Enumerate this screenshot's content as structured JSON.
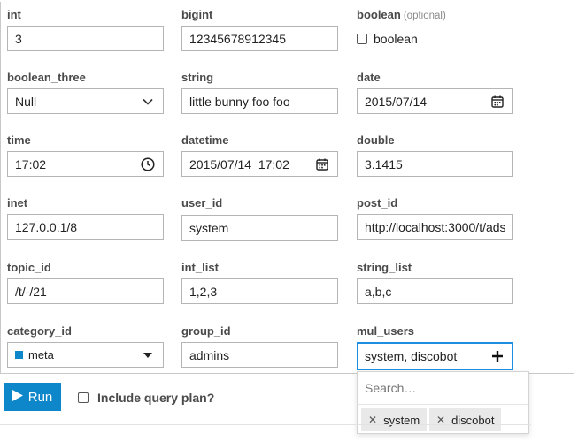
{
  "fields": {
    "int": {
      "label": "int",
      "value": "3"
    },
    "bigint": {
      "label": "bigint",
      "value": "12345678912345"
    },
    "boolean": {
      "label": "boolean",
      "optional": "(optional)",
      "checkbox_label": "boolean"
    },
    "boolean_three": {
      "label": "boolean_three",
      "value": "Null"
    },
    "string": {
      "label": "string",
      "value": "little bunny foo foo"
    },
    "date": {
      "label": "date",
      "value": "2015/07/14"
    },
    "time": {
      "label": "time",
      "value": "17:02"
    },
    "datetime": {
      "label": "datetime",
      "value": "2015/07/14  17:02"
    },
    "double": {
      "label": "double",
      "value": "3.1415"
    },
    "inet": {
      "label": "inet",
      "value": "127.0.0.1/8"
    },
    "user_id": {
      "label": "user_id",
      "value": "system"
    },
    "post_id": {
      "label": "post_id",
      "value": "http://localhost:3000/t/ads"
    },
    "topic_id": {
      "label": "topic_id",
      "value": "/t/-/21"
    },
    "int_list": {
      "label": "int_list",
      "value": "1,2,3"
    },
    "string_list": {
      "label": "string_list",
      "value": "a,b,c"
    },
    "category_id": {
      "label": "category_id",
      "value": "meta",
      "swatch_color": "#0e86ca"
    },
    "group_id": {
      "label": "group_id",
      "value": "admins"
    },
    "mul_users": {
      "label": "mul_users",
      "value": "system, discobot"
    }
  },
  "user_dropdown": {
    "search_placeholder": "Search…",
    "selected": [
      "system",
      "discobot"
    ],
    "remove_glyph": "✕"
  },
  "actions": {
    "run_label": "Run",
    "include_plan_label": "Include query plan?"
  },
  "colors": {
    "primary": "#0e86ca",
    "focus": "#1e8fe0"
  }
}
